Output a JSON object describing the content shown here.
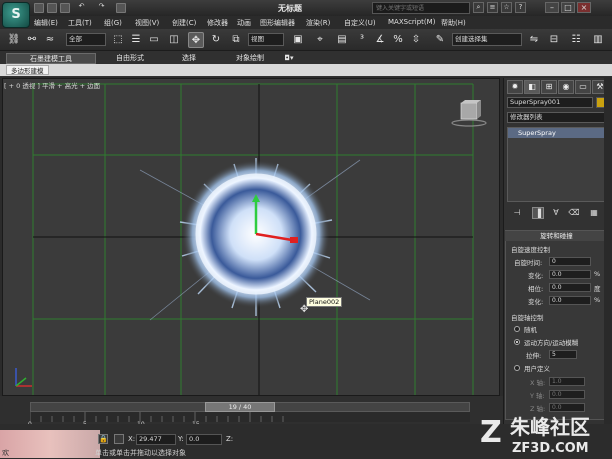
{
  "app": {
    "logo_text": "S",
    "window_title": "无标题",
    "search_placeholder": "键入关键字或短语"
  },
  "menu": [
    "编辑(E)",
    "工具(T)",
    "组(G)",
    "视图(V)",
    "创建(C)",
    "修改器",
    "动画",
    "图形编辑器",
    "渲染(R)",
    "自定义(U)",
    "MAXScript(M)",
    "帮助(H)"
  ],
  "toolbar": {
    "selection_filter": "全部",
    "ref_coord": "视图",
    "named_selection": "创建选择集"
  },
  "ribbon": {
    "tabs": [
      "石墨建模工具",
      "自由形式",
      "选择",
      "对象绘制"
    ],
    "sub_tab": "多边形建模"
  },
  "viewport": {
    "label": "[ + 0 透视 ] 平滑 + 高光 + 边面",
    "object_label": "Plane002"
  },
  "timeline": {
    "frame_display": "19 / 40",
    "ticks": [
      "0",
      "5",
      "10",
      "15"
    ]
  },
  "status": {
    "x_label": "X:",
    "x_value": "29.477",
    "y_label": "Y:",
    "y_value": "0.0",
    "z_label": "Z:",
    "prompt": "单击或单击并拖动以选择对象",
    "prompt_left": "欢"
  },
  "panel": {
    "object_name": "SuperSpray001",
    "object_color": "#c9a10f",
    "modifier_list": "修改器列表",
    "stack_item": "SuperSpray",
    "rollout_title": "旋转和碰撞",
    "spin_speed_section": "自旋速度控制",
    "spin_time_label": "自旋时间:",
    "spin_time_value": "0",
    "variation_label": "变化:",
    "variation_value": "0.0",
    "phase_label": "相位:",
    "phase_value": "0.0",
    "phase_unit": "度",
    "variation2_label": "变化:",
    "variation2_value": "0.0",
    "pct": "%",
    "spin_axis_section": "自旋轴控制",
    "radio_random": "随机",
    "radio_motion": "运动方向/运动模糊",
    "stretch_label": "拉伸:",
    "stretch_value": "5",
    "radio_user": "用户定义",
    "xaxis_label": "X 轴:",
    "xaxis_value": "1.0",
    "yaxis_label": "Y 轴:",
    "yaxis_value": "0.0",
    "zaxis_label": "Z 轴:",
    "zaxis_value": "0.0"
  },
  "watermark": {
    "brand": "朱峰社区",
    "url": "ZF3D.COM"
  }
}
